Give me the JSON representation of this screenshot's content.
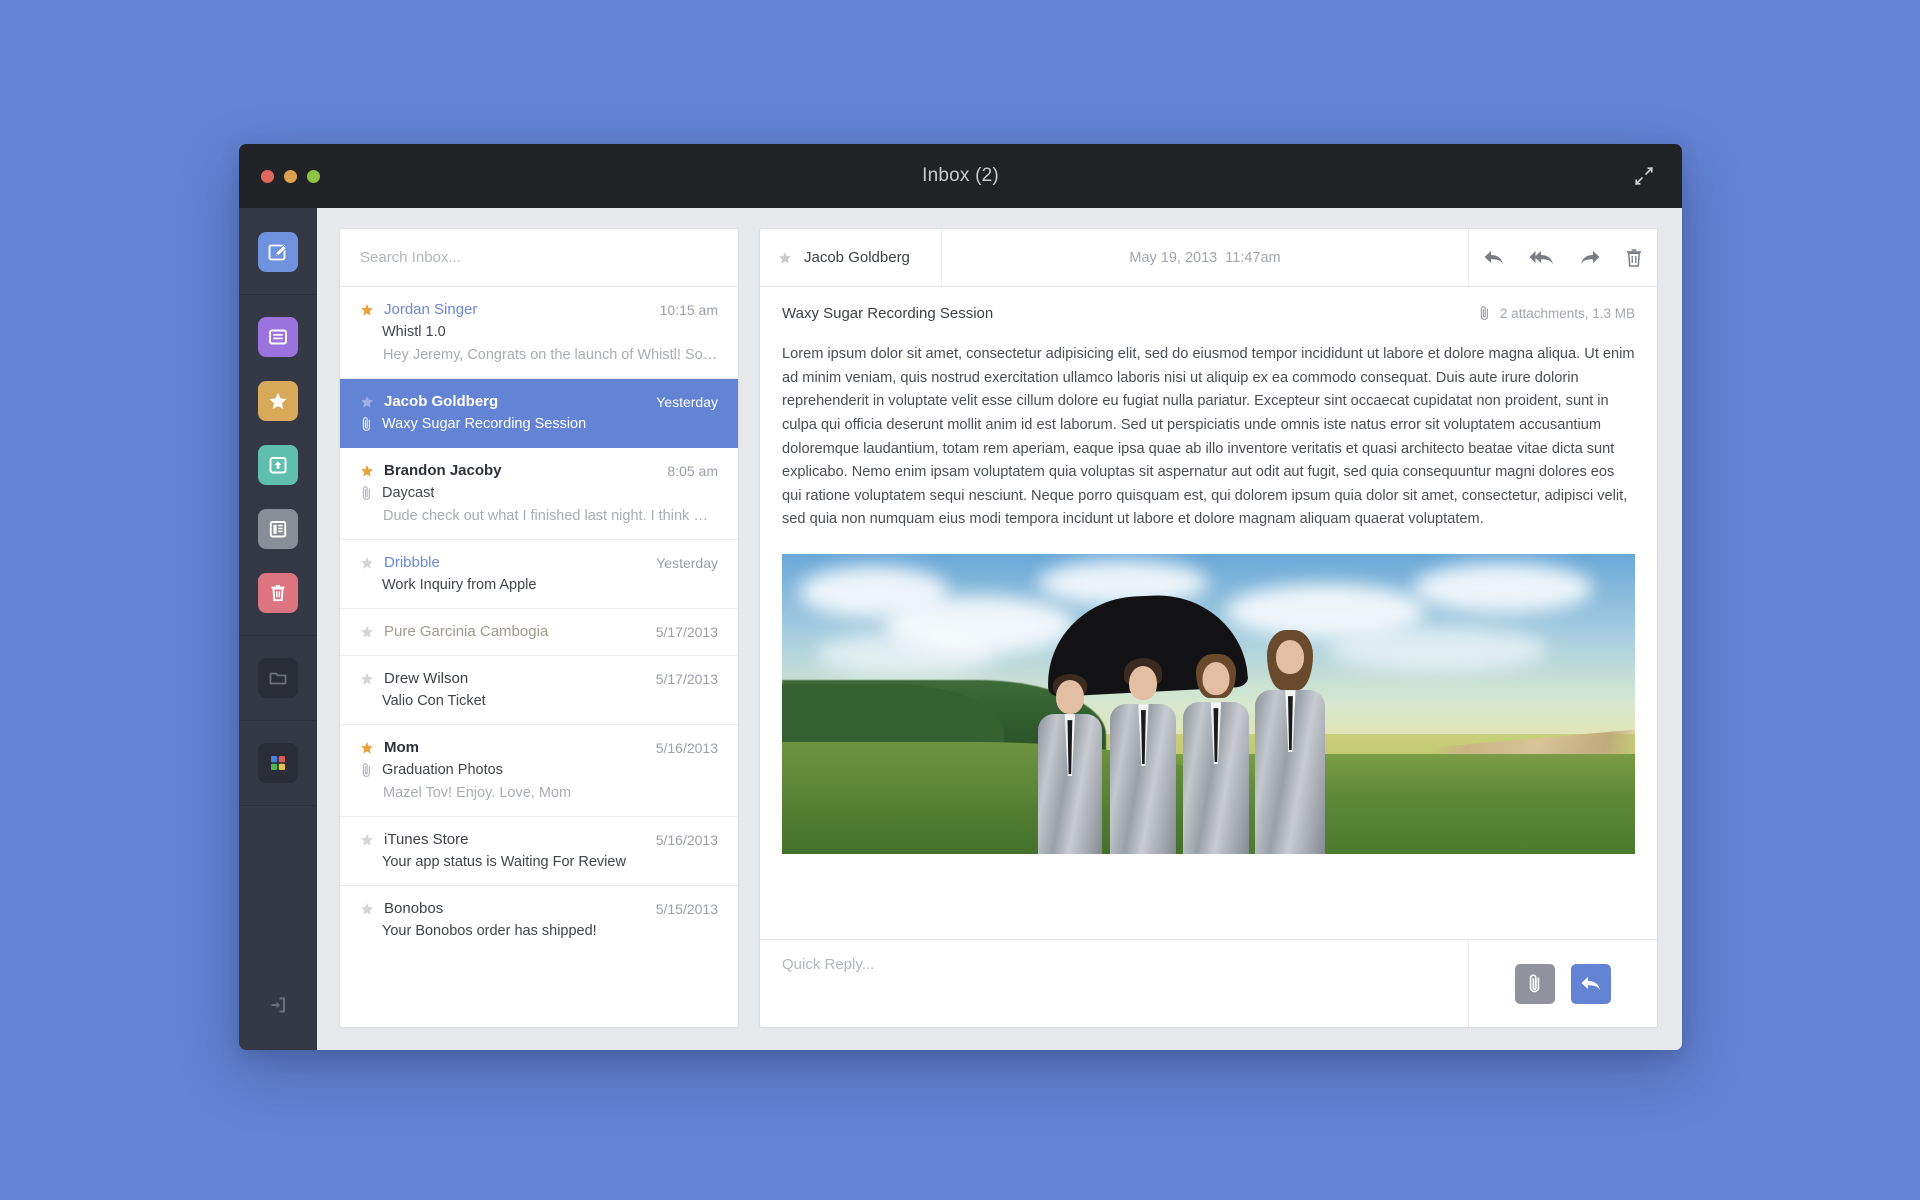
{
  "desktop": {
    "background": "#6383d4"
  },
  "window": {
    "title": "Inbox (2)",
    "titlebar_bg": "#212226",
    "controls": {
      "close_label": "Close",
      "minimize_label": "Minimize",
      "zoom_label": "Zoom"
    },
    "expand_icon": "expand-arrows-icon"
  },
  "sidebar": {
    "background": "#343845",
    "items": [
      {
        "name": "compose",
        "label": "Compose",
        "icon": "compose-pencil-icon",
        "color": "#6e92de"
      },
      {
        "name": "inbox",
        "label": "Inbox",
        "icon": "message-icon",
        "color": "#9b72de"
      },
      {
        "name": "starred",
        "label": "Starred",
        "icon": "star-icon",
        "color": "#d9a95a"
      },
      {
        "name": "archive",
        "label": "Archive",
        "icon": "archive-upload-icon",
        "color": "#5fbfae"
      },
      {
        "name": "news",
        "label": "Reading List",
        "icon": "newspaper-icon",
        "color": "#898d97"
      },
      {
        "name": "trash",
        "label": "Trash",
        "icon": "trash-icon",
        "color": "#dc7580"
      },
      {
        "name": "folders",
        "label": "Folders",
        "icon": "folder-icon",
        "color": "#2a2d38"
      },
      {
        "name": "apps",
        "label": "Apps",
        "icon": "apps-grid-icon",
        "color": "#2a2d38"
      }
    ],
    "apps_colors": [
      "#4a7fe0",
      "#e05a5a",
      "#4bb552",
      "#e0c24a"
    ],
    "logout": {
      "label": "Sign Out",
      "icon": "logout-icon"
    }
  },
  "search": {
    "placeholder": "Search Inbox...",
    "value": ""
  },
  "mail_list": [
    {
      "sender": "Jordan Singer",
      "sender_style": "link",
      "time": "10:15 am",
      "subject": "Whistl 1.0",
      "snippet": "Hey Jeremy, Congrats on the launch of Whistl! So gla...",
      "starred": true,
      "attachment": false,
      "selected": false
    },
    {
      "sender": "Jacob Goldberg",
      "sender_style": "bold",
      "time": "Yesterday",
      "subject": "Waxy Sugar Recording Session",
      "snippet": "",
      "starred": false,
      "attachment": true,
      "selected": true
    },
    {
      "sender": "Brandon Jacoby",
      "sender_style": "bold",
      "time": "8:05 am",
      "subject": "Daycast",
      "snippet": "Dude check out what I finished last night. I think wer...",
      "starred": true,
      "attachment": true,
      "selected": false
    },
    {
      "sender": "Dribbble",
      "sender_style": "link",
      "time": "Yesterday",
      "subject": "Work Inquiry from Apple",
      "snippet": "",
      "starred": false,
      "attachment": false,
      "selected": false
    },
    {
      "sender": "Pure Garcinia Cambogia",
      "sender_style": "muted",
      "time": "5/17/2013",
      "subject": "",
      "snippet": "",
      "starred": false,
      "attachment": false,
      "selected": false
    },
    {
      "sender": "Drew Wilson",
      "sender_style": "normal",
      "time": "5/17/2013",
      "subject": "Valio Con Ticket",
      "snippet": "",
      "starred": false,
      "attachment": false,
      "selected": false
    },
    {
      "sender": "Mom",
      "sender_style": "bold",
      "time": "5/16/2013",
      "subject": "Graduation Photos",
      "snippet": "Mazel Tov! Enjoy. Love, Mom",
      "starred": true,
      "attachment": true,
      "selected": false
    },
    {
      "sender": "iTunes Store",
      "sender_style": "normal",
      "time": "5/16/2013",
      "subject": "Your app status is Waiting For Review",
      "snippet": "",
      "starred": false,
      "attachment": false,
      "selected": false
    },
    {
      "sender": "Bonobos",
      "sender_style": "normal",
      "time": "5/15/2013",
      "subject": "Your Bonobos order has shipped!",
      "snippet": "",
      "starred": false,
      "attachment": false,
      "selected": false
    }
  ],
  "reading_pane": {
    "sender": "Jacob Goldberg",
    "starred": false,
    "date": "May 19, 2013",
    "time": "11:47am",
    "subject": "Waxy Sugar Recording Session",
    "attachments_text": "2 attachments, 1.3 MB",
    "actions": [
      {
        "name": "reply",
        "label": "Reply",
        "icon": "reply-arrow-icon"
      },
      {
        "name": "reply-all",
        "label": "Reply All",
        "icon": "reply-all-arrow-icon"
      },
      {
        "name": "forward",
        "label": "Forward",
        "icon": "forward-arrow-icon"
      },
      {
        "name": "delete",
        "label": "Delete",
        "icon": "trash-icon"
      }
    ],
    "body": "Lorem ipsum dolor sit amet, consectetur adipisicing elit, sed do eiusmod tempor incididunt ut labore et dolore magna aliqua. Ut enim ad minim veniam, quis nostrud exercitation ullamco laboris nisi ut aliquip ex ea commodo consequat. Duis aute irure dolorin reprehenderit in voluptate velit esse cillum dolore eu fugiat nulla pariatur. Excepteur sint occaecat cupidatat non proident, sunt in culpa qui officia deserunt mollit anim id est laborum. Sed ut perspiciatis unde omnis iste natus error sit voluptatem accusantium doloremque laudantium, totam rem aperiam, eaque ipsa quae ab illo inventore veritatis et quasi architecto beatae vitae dicta sunt explicabo. Nemo enim ipsam voluptatem quia voluptas sit aspernatur aut odit aut fugit, sed quia consequuntur magni dolores eos qui ratione voluptatem sequi nesciunt. Neque porro quisquam est, qui dolorem ipsum quia dolor sit amet, consectetur, adipisci velit, sed quia non numquam eius modi tempora incidunt ut labore et dolore magnam aliquam quaerat voluptatem.",
    "image_description": "Four band members in silver suits standing under a large black umbrella in a sunlit field beside a dirt road"
  },
  "quick_reply": {
    "placeholder": "Quick Reply...",
    "value": "",
    "attach": {
      "label": "Attach file",
      "icon": "paperclip-icon",
      "color": "#90939d"
    },
    "send": {
      "label": "Send Reply",
      "icon": "reply-arrow-icon",
      "color": "#6383d4"
    }
  }
}
